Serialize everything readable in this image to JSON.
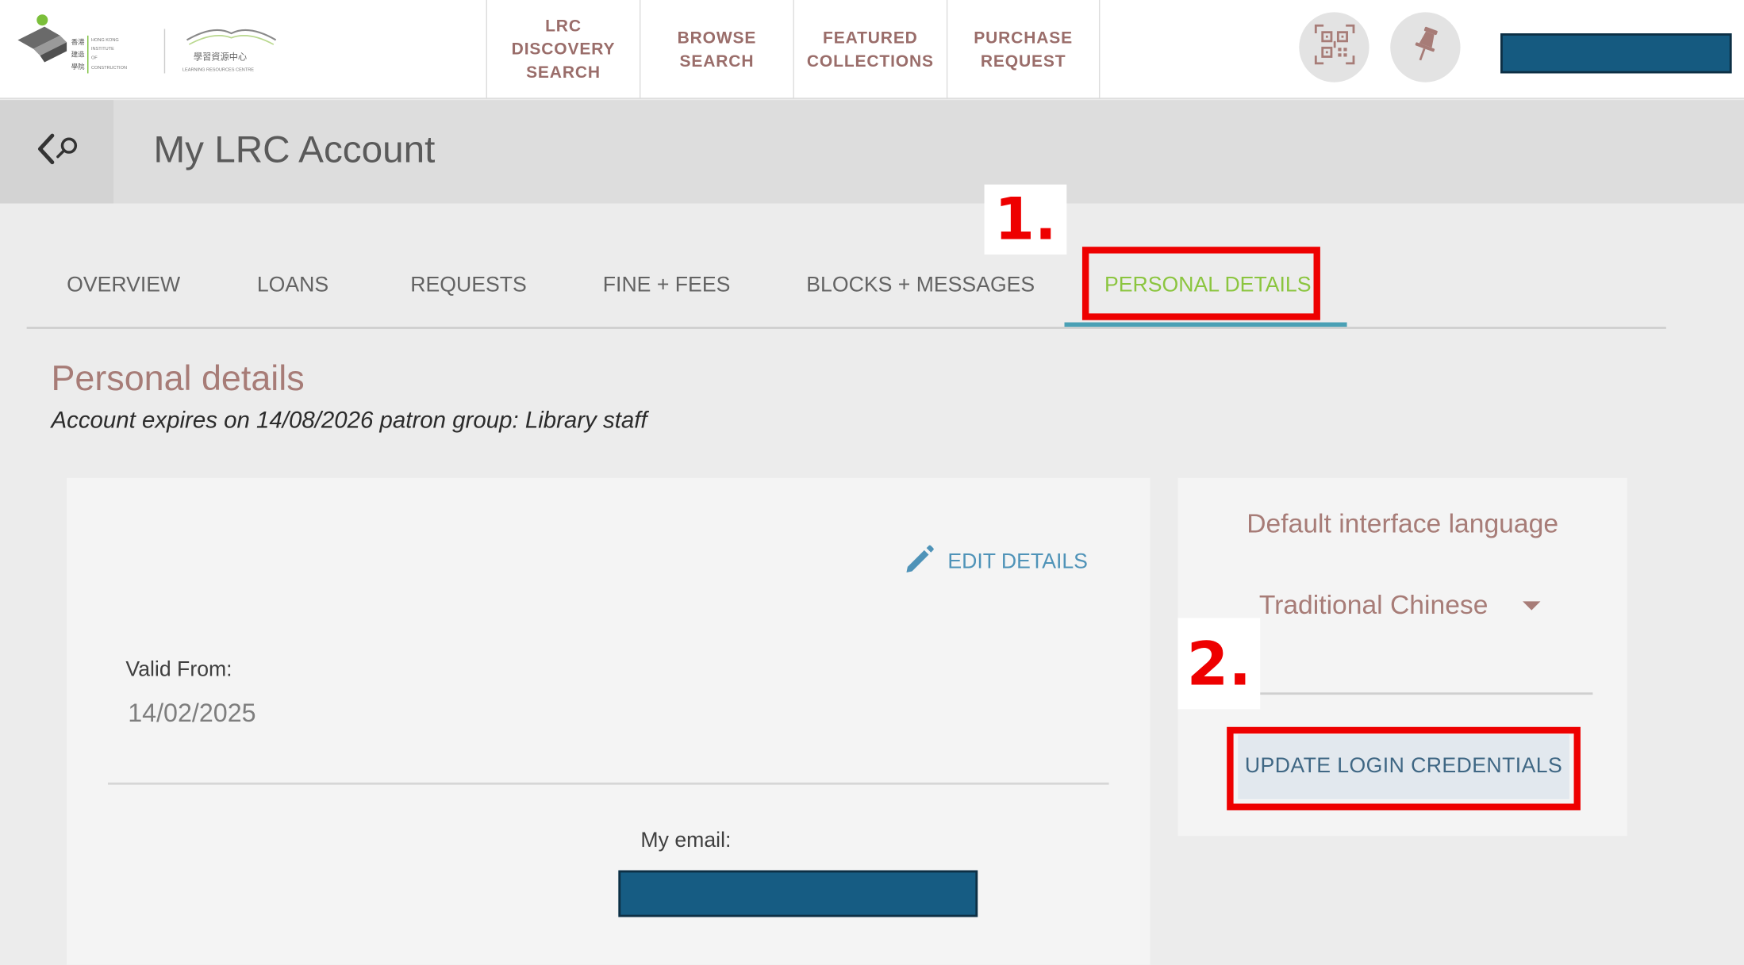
{
  "logo": {
    "institute_lines": [
      "香港",
      "建造",
      "學院"
    ],
    "institute_en": [
      "HONG KONG",
      "INSTITUTE",
      "OF",
      "CONSTRUCTION"
    ],
    "lrc_cn": "學習資源中心",
    "lrc_en": "LEARNING RESOURCES CENTRE"
  },
  "nav": {
    "items": [
      {
        "label": "LRC\nDISCOVERY\nSEARCH"
      },
      {
        "label": "BROWSE\nSEARCH"
      },
      {
        "label": "FEATURED\nCOLLECTIONS"
      },
      {
        "label": "PURCHASE\nREQUEST"
      }
    ],
    "icons": [
      "qr-code-icon",
      "pin-icon"
    ]
  },
  "header": {
    "title": "My LRC Account"
  },
  "tabs": [
    {
      "label": "OVERVIEW"
    },
    {
      "label": "LOANS"
    },
    {
      "label": "REQUESTS"
    },
    {
      "label": "FINE + FEES"
    },
    {
      "label": "BLOCKS + MESSAGES"
    },
    {
      "label": "PERSONAL DETAILS",
      "active": true
    }
  ],
  "annotations": {
    "step1": "1.",
    "step2": "2."
  },
  "section": {
    "title": "Personal details",
    "subtitle": "Account expires on 14/08/2026 patron group: Library staff"
  },
  "details_card": {
    "edit_label": "EDIT DETAILS",
    "valid_from_label": "Valid From:",
    "valid_from_value": "14/02/2025",
    "email_label": "My email:"
  },
  "language_card": {
    "label": "Default interface language",
    "selected": "Traditional Chinese",
    "update_button": "UPDATE LOGIN CREDENTIALS"
  },
  "colors": {
    "accent_green": "#8bc53f",
    "tab_underline": "#4aa0b5",
    "highlight_red": "#ee0000",
    "redaction_blue": "#155a80",
    "heading_rose": "#a77c77"
  }
}
